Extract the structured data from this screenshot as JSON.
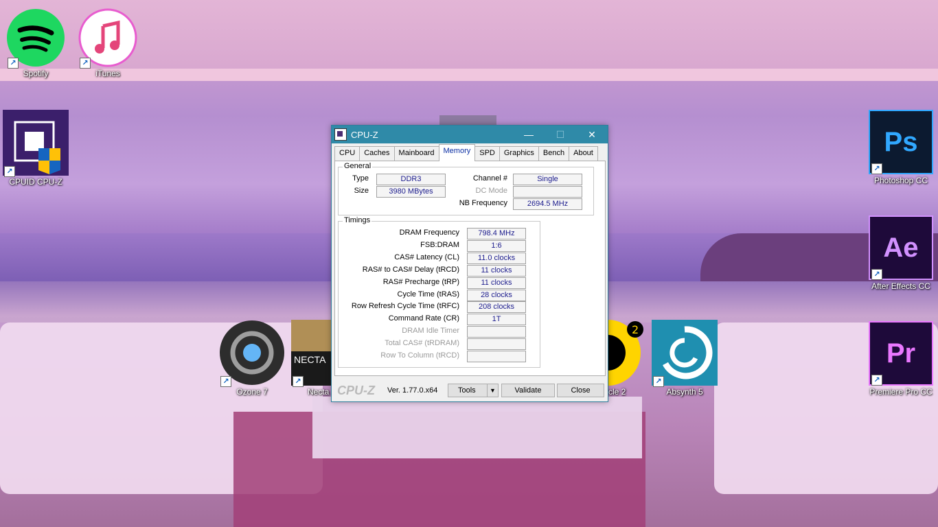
{
  "desktop": {
    "icons": [
      {
        "label": "Spotify",
        "icon": "spotify-icon",
        "color": "#1ed760"
      },
      {
        "label": "iTunes",
        "icon": "itunes-icon",
        "color": "#ffffff"
      },
      {
        "label": "CPUID CPU-Z",
        "icon": "cpu-z-icon",
        "color": "#3b1f6b"
      },
      {
        "label": "Ozone 7",
        "icon": "ozone-icon",
        "color": "#2d2d2d"
      },
      {
        "label": "Necta",
        "icon": "nectar-icon",
        "color": "#b08f56"
      },
      {
        "label": "rcle 2",
        "icon": "circle2-icon",
        "color": "#ffd400"
      },
      {
        "label": "Absynth 5",
        "icon": "absynth-icon",
        "color": "#1f8fb0"
      },
      {
        "label": "Photoshop CC",
        "icon": "photoshop-icon",
        "color": "#0c1a30",
        "abbr": "Ps"
      },
      {
        "label": "After Effects CC",
        "icon": "after-effects-icon",
        "color": "#1e0a3a",
        "abbr": "Ae"
      },
      {
        "label": "Premiere Pro CC",
        "icon": "premiere-icon",
        "color": "#1e0a3a",
        "abbr": "Pr"
      }
    ]
  },
  "window": {
    "title": "CPU-Z",
    "controls": {
      "minimize": "—",
      "maximize": "☐",
      "close": "✕"
    },
    "tabs": [
      "CPU",
      "Caches",
      "Mainboard",
      "Memory",
      "SPD",
      "Graphics",
      "Bench",
      "About"
    ],
    "active_tab": "Memory",
    "general": {
      "title": "General",
      "type_label": "Type",
      "type_value": "DDR3",
      "size_label": "Size",
      "size_value": "3980 MBytes",
      "channel_label": "Channel #",
      "channel_value": "Single",
      "dcmode_label": "DC Mode",
      "dcmode_value": "",
      "nbfreq_label": "NB Frequency",
      "nbfreq_value": "2694.5 MHz"
    },
    "timings": {
      "title": "Timings",
      "rows": [
        {
          "label": "DRAM Frequency",
          "value": "798.4 MHz",
          "disabled": false
        },
        {
          "label": "FSB:DRAM",
          "value": "1:6",
          "disabled": false
        },
        {
          "label": "CAS# Latency (CL)",
          "value": "11.0 clocks",
          "disabled": false
        },
        {
          "label": "RAS# to CAS# Delay (tRCD)",
          "value": "11 clocks",
          "disabled": false
        },
        {
          "label": "RAS# Precharge (tRP)",
          "value": "11 clocks",
          "disabled": false
        },
        {
          "label": "Cycle Time (tRAS)",
          "value": "28 clocks",
          "disabled": false
        },
        {
          "label": "Row Refresh Cycle Time (tRFC)",
          "value": "208 clocks",
          "disabled": false
        },
        {
          "label": "Command Rate (CR)",
          "value": "1T",
          "disabled": false
        },
        {
          "label": "DRAM Idle Timer",
          "value": "",
          "disabled": true
        },
        {
          "label": "Total CAS# (tRDRAM)",
          "value": "",
          "disabled": true
        },
        {
          "label": "Row To Column (tRCD)",
          "value": "",
          "disabled": true
        }
      ]
    },
    "footer": {
      "brand": "CPU-Z",
      "version": "Ver. 1.77.0.x64",
      "tools_label": "Tools",
      "tools_arrow": "▼",
      "validate_label": "Validate",
      "close_label": "Close"
    }
  }
}
